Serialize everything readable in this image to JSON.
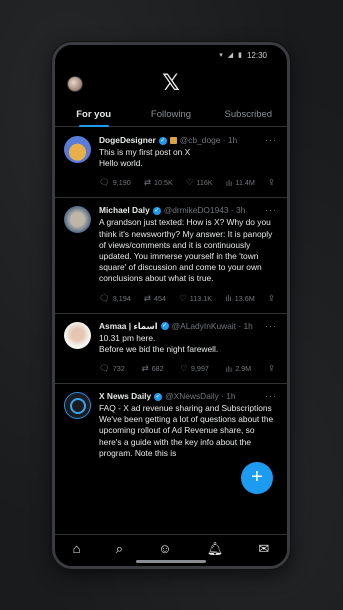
{
  "status": {
    "time": "12:30",
    "icons": [
      "wifi-icon",
      "signal-icon",
      "battery-icon"
    ]
  },
  "header": {
    "logo": "𝕏"
  },
  "tabs": [
    {
      "label": "For you",
      "active": true
    },
    {
      "label": "Following",
      "active": false
    },
    {
      "label": "Subscribed",
      "active": false
    }
  ],
  "posts": [
    {
      "name": "DogeDesigner",
      "handle": "@cb_doge · 1h",
      "text": "This is my first post on X\nHello world.",
      "reply": "9,190",
      "repost": "10.5K",
      "like": "116K",
      "views": "11.4M"
    },
    {
      "name": "Michael Daly",
      "handle": "@drmikeDO1943 · 3h",
      "text": "A grandson just texted: How is X? Why do you think it's newsworthy? My answer: It is panoply of views/comments and it is continuously updated. You immerse yourself in the 'town square' of discussion and come to your own conclusions about what is true.",
      "reply": "3,194",
      "repost": "454",
      "like": "113.1K",
      "views": "13.6M"
    },
    {
      "name": "Asmaa | اسماء",
      "handle": "@ALadyInKuwait · 1h",
      "text": "10.31 pm here.\nBefore we bid the night farewell.",
      "reply": "732",
      "repost": "682",
      "like": "9,997",
      "views": "2.9M"
    },
    {
      "name": "X News Daily",
      "handle": "@XNewsDaily · 1h",
      "text": "FAQ - X ad revenue sharing and Subscriptions\nWe've been getting a lot of questions about the upcoming rollout of Ad Revenue share, so here's a guide with the key info about the program. Note this is",
      "reply": "",
      "repost": "",
      "like": "",
      "views": ""
    }
  ],
  "fab": {
    "label": "+"
  },
  "nav": [
    "home-icon",
    "search-icon",
    "communities-icon",
    "notifications-icon",
    "messages-icon"
  ]
}
